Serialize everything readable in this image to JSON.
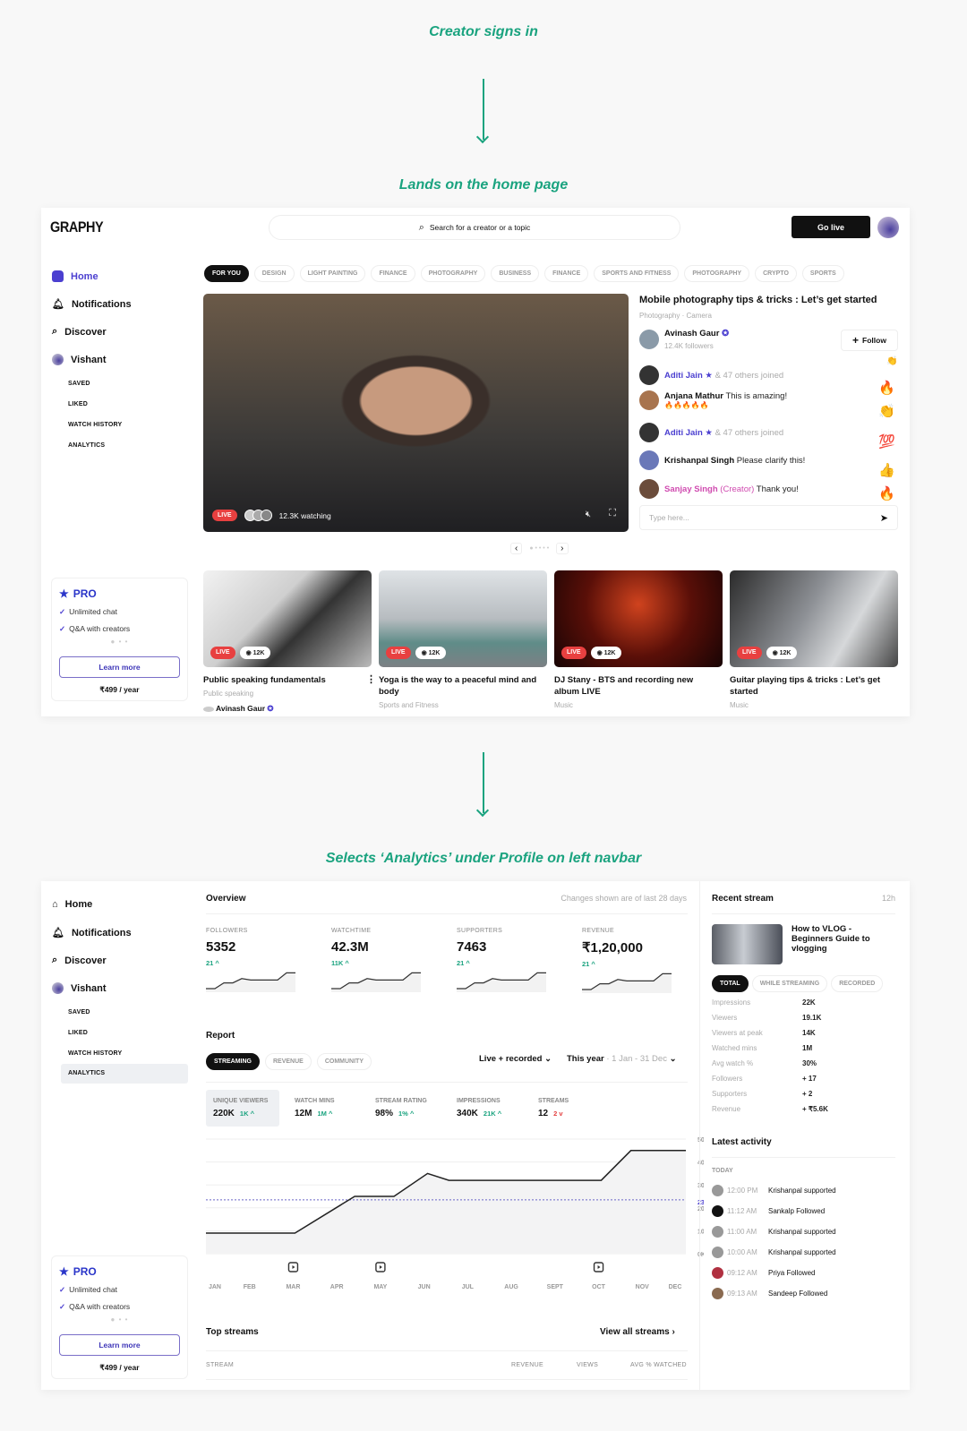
{
  "captions": [
    "Creator signs in",
    "Lands on the home page",
    "Selects ‘Analytics’ under Profile on left navbar"
  ],
  "colors": {
    "accent": "#1aa37f",
    "brand": "#4b3fd0",
    "live": "#e84040"
  },
  "home": {
    "logo": "GRAPHY",
    "search_placeholder": "Search for a creator or a topic",
    "go_live": "Go live",
    "nav": [
      {
        "label": "Home",
        "icon": "home-icon"
      },
      {
        "label": "Notifications",
        "icon": "bell-icon"
      },
      {
        "label": "Discover",
        "icon": "search-icon"
      },
      {
        "label": "Vishant",
        "icon": "avatar"
      }
    ],
    "sub_nav": [
      "SAVED",
      "LIKED",
      "WATCH HISTORY",
      "ANALYTICS"
    ],
    "chips": [
      "FOR YOU",
      "DESIGN",
      "LIGHT PAINTING",
      "FINANCE",
      "PHOTOGRAPHY",
      "BUSINESS",
      "FINANCE",
      "SPORTS AND FITNESS",
      "PHOTOGRAPHY",
      "CRYPTO",
      "SPORTS"
    ],
    "featured": {
      "live": "LIVE",
      "watching": "12.3K watching",
      "title": "Mobile photography tips & tricks : Let’s get started",
      "category": "Photography · Camera",
      "creator": "Avinash Gaur",
      "followers": "12.4K followers",
      "follow": "Follow"
    },
    "chat": [
      {
        "name": "Aditi Jain",
        "star": "★",
        "text": "& 47 others joined",
        "type": "join"
      },
      {
        "name": "Anjana Mathur",
        "text": "This is amazing!",
        "extra": "🔥🔥🔥🔥🔥",
        "type": "msg"
      },
      {
        "name": "Aditi Jain",
        "star": "★",
        "text": "& 47 others joined",
        "type": "join"
      },
      {
        "name": "Krishanpal Singh",
        "text": "Please clarify this!",
        "type": "msg"
      },
      {
        "name": "Sanjay Singh",
        "tag": "(Creator)",
        "text": "Thank you!",
        "type": "creator"
      }
    ],
    "reactions": [
      "👏",
      "🔥",
      "👏",
      "💯",
      "👍",
      "🔥"
    ],
    "chat_placeholder": "Type here...",
    "pro": {
      "title": "PRO",
      "features": [
        "Unlimited chat",
        "Q&A with creators"
      ],
      "button": "Learn more",
      "price": "₹499 / year"
    },
    "streams": [
      {
        "title": "Public speaking fundamentals",
        "category": "Public speaking",
        "creator": "Avinash Gaur",
        "live": "LIVE",
        "views": "12K"
      },
      {
        "title": "Yoga is the way to a peaceful mind and body",
        "category": "Sports and Fitness",
        "live": "LIVE",
        "views": "12K"
      },
      {
        "title": "DJ Stany - BTS and recording new album LIVE",
        "category": "Music",
        "live": "LIVE",
        "views": "12K"
      },
      {
        "title": "Guitar playing tips & tricks : Let’s get started",
        "category": "Music",
        "live": "LIVE",
        "views": "12K"
      }
    ]
  },
  "analytics": {
    "overview_title": "Overview",
    "overview_note": "Changes shown are of last 28 days",
    "metrics": [
      {
        "label": "FOLLOWERS",
        "value": "5352",
        "delta": "21 ^"
      },
      {
        "label": "WATCHTIME",
        "value": "42.3M",
        "delta": "11K ^"
      },
      {
        "label": "SUPPORTERS",
        "value": "7463",
        "delta": "21 ^"
      },
      {
        "label": "REVENUE",
        "value": "₹1,20,000",
        "delta": "21 ^"
      }
    ],
    "report_title": "Report",
    "report_tabs": [
      "STREAMING",
      "REVENUE",
      "COMMUNITY"
    ],
    "filter_type": "Live + recorded",
    "filter_period": "This year",
    "filter_range": "· 1 Jan - 31 Dec",
    "stats": [
      {
        "label": "UNIQUE VIEWERS",
        "value": "220K",
        "delta": "1K ^",
        "dir": "up"
      },
      {
        "label": "WATCH MINS",
        "value": "12M",
        "delta": "1M ^",
        "dir": "up"
      },
      {
        "label": "STREAM RATING",
        "value": "98%",
        "delta": "1% ^",
        "dir": "up"
      },
      {
        "label": "IMPRESSIONS",
        "value": "340K",
        "delta": "21K ^",
        "dir": "up"
      },
      {
        "label": "STREAMS",
        "value": "12",
        "delta": "2 v",
        "dir": "down"
      }
    ],
    "top_streams_title": "Top streams",
    "view_all": "View all streams",
    "table_headers": [
      "STREAM",
      "REVENUE",
      "VIEWS",
      "AVG % WATCHED"
    ],
    "recent": {
      "title": "Recent stream",
      "age": "12h",
      "stream_title": "How to VLOG - Beginners Guide to vlogging",
      "tabs": [
        "TOTAL",
        "WHILE STREAMING",
        "RECORDED"
      ],
      "rows": [
        [
          "Impressions",
          "22K"
        ],
        [
          "Viewers",
          "19.1K"
        ],
        [
          "Viewers at peak",
          "14K"
        ],
        [
          "Watched mins",
          "1M"
        ],
        [
          "Avg watch %",
          "30%"
        ],
        [
          "Followers",
          "+ 17"
        ],
        [
          "Supporters",
          "+ 2"
        ],
        [
          "Revenue",
          "+ ₹5.6K"
        ]
      ]
    },
    "activity": {
      "title": "Latest activity",
      "day": "TODAY",
      "items": [
        [
          "12:00 PM",
          "Krishanpal supported"
        ],
        [
          "11:12 AM",
          "Sankalp Followed"
        ],
        [
          "11:00 AM",
          "Krishanpal supported"
        ],
        [
          "10:00 AM",
          "Krishanpal supported"
        ],
        [
          "09:12 AM",
          "Priya Followed"
        ],
        [
          "09:13 AM",
          "Sandeep Followed"
        ]
      ]
    }
  },
  "chart_data": {
    "type": "area",
    "categories": [
      "JAN",
      "FEB",
      "MAR",
      "APR",
      "MAY",
      "JUN",
      "JUL",
      "AUG",
      "SEPT",
      "OCT",
      "NOV",
      "DEC"
    ],
    "points": [
      [
        1,
        9
      ],
      [
        3.04,
        9
      ],
      [
        4.41,
        25
      ],
      [
        5.31,
        25
      ],
      [
        6.08,
        35
      ],
      [
        6.57,
        32
      ],
      [
        10.06,
        32
      ],
      [
        10.74,
        45
      ],
      [
        12,
        45
      ]
    ],
    "y_unit": "K",
    "ylim": [
      0,
      50
    ],
    "y_ticks": [
      "50K",
      "40K",
      "30K",
      "20K",
      "10K",
      "0K"
    ],
    "reference": {
      "value": 23.5,
      "label": "23K"
    },
    "stream_markers": [
      "MAR",
      "MAY",
      "OCT"
    ],
    "grid": true,
    "sparkline": [
      [
        0,
        0
      ],
      [
        1,
        0
      ],
      [
        2,
        4
      ],
      [
        3,
        4
      ],
      [
        4,
        7
      ],
      [
        5,
        6
      ],
      [
        6,
        6
      ],
      [
        7,
        6
      ],
      [
        8,
        6
      ],
      [
        9,
        11
      ],
      [
        10,
        11
      ]
    ]
  }
}
